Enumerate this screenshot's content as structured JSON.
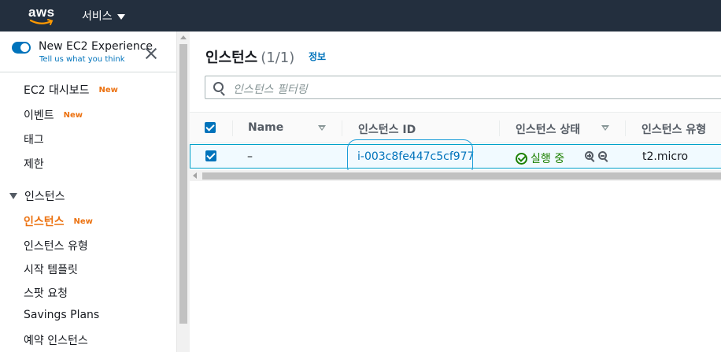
{
  "topbar": {
    "logo_text": "aws",
    "services_label": "서비스"
  },
  "experience": {
    "title": "New EC2 Experience",
    "link": "Tell us what you think",
    "enabled": true
  },
  "sidebar": {
    "items": [
      {
        "label": "EC2 대시보드",
        "badge": "New"
      },
      {
        "label": "이벤트",
        "badge": "New"
      },
      {
        "label": "태그"
      },
      {
        "label": "제한"
      }
    ],
    "section": "인스턴스",
    "section_items": [
      {
        "label": "인스턴스",
        "badge": "New",
        "active": true
      },
      {
        "label": "인스턴스 유형"
      },
      {
        "label": "시작 템플릿"
      },
      {
        "label": "스팟 요청"
      },
      {
        "label": "Savings Plans"
      },
      {
        "label": "예약 인스턴스"
      }
    ]
  },
  "main": {
    "title": "인스턴스",
    "count": "(1/1)",
    "info": "정보",
    "filter_placeholder": "인스턴스 필터링",
    "columns": [
      "Name",
      "인스턴스 ID",
      "인스턴스 상태",
      "인스턴스 유형"
    ],
    "rows": [
      {
        "selected": true,
        "name": "–",
        "instance_id": "i-003c8fe447c5cf977",
        "state": "실행 중",
        "type": "t2.micro"
      }
    ]
  },
  "colors": {
    "topbar": "#232f3e",
    "accent": "#0073bb",
    "active": "#ec7211",
    "running": "#1d8102",
    "highlight": "#1a9cd9"
  }
}
